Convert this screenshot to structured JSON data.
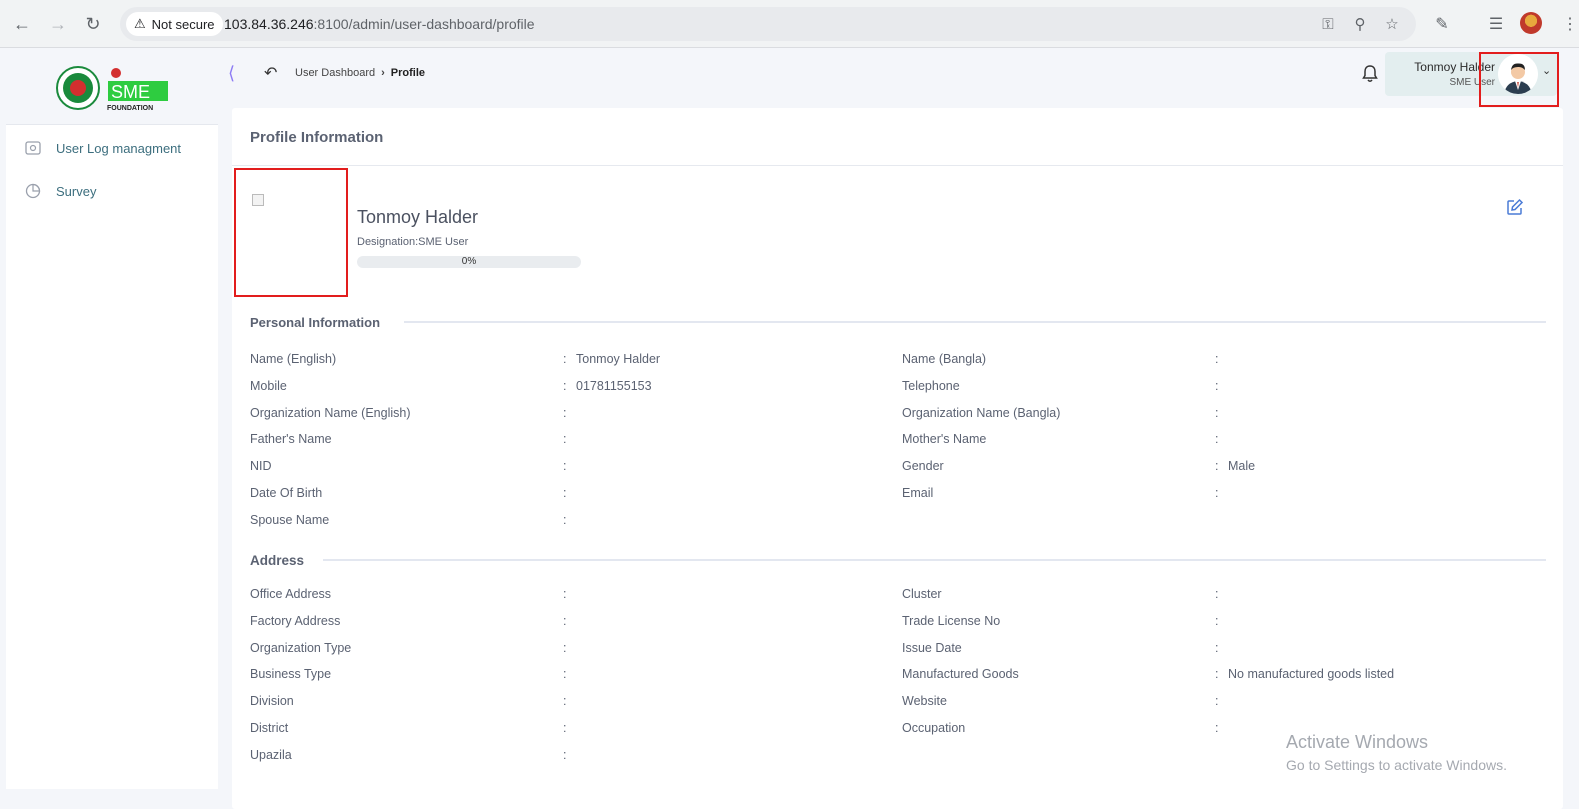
{
  "browser": {
    "security_label": "Not secure",
    "url_host": "103.84.36.246",
    "url_rest": ":8100/admin/user-dashboard/profile"
  },
  "sidebar": {
    "items": [
      {
        "label": "User Log managment",
        "icon": "log-icon"
      },
      {
        "label": "Survey",
        "icon": "pie-chart-icon"
      }
    ]
  },
  "header": {
    "breadcrumb": [
      "User Dashboard",
      "Profile"
    ],
    "user_name": "Tonmoy Halder",
    "user_role": "SME User"
  },
  "profile": {
    "card_title": "Profile Information",
    "name": "Tonmoy Halder",
    "designation": "Designation:SME User",
    "progress_text": "0%",
    "progress_value": 0
  },
  "personal": {
    "title": "Personal Information",
    "left": [
      {
        "label": "Name (English)",
        "value": "Tonmoy Halder"
      },
      {
        "label": "Mobile",
        "value": "01781155153"
      },
      {
        "label": "Organization Name (English)",
        "value": ""
      },
      {
        "label": "Father's Name",
        "value": ""
      },
      {
        "label": "NID",
        "value": ""
      },
      {
        "label": "Date Of Birth",
        "value": ""
      },
      {
        "label": "Spouse Name",
        "value": ""
      }
    ],
    "right": [
      {
        "label": "Name (Bangla)",
        "value": ""
      },
      {
        "label": "Telephone",
        "value": ""
      },
      {
        "label": "Organization Name (Bangla)",
        "value": ""
      },
      {
        "label": "Mother's Name",
        "value": ""
      },
      {
        "label": "Gender",
        "value": "Male"
      },
      {
        "label": "Email",
        "value": ""
      }
    ]
  },
  "address": {
    "title": "Address",
    "left": [
      {
        "label": "Office Address",
        "value": ""
      },
      {
        "label": "Factory Address",
        "value": ""
      },
      {
        "label": "Organization Type",
        "value": ""
      },
      {
        "label": "Business Type",
        "value": ""
      },
      {
        "label": "Division",
        "value": ""
      },
      {
        "label": "District",
        "value": ""
      },
      {
        "label": "Upazila",
        "value": ""
      }
    ],
    "right": [
      {
        "label": "Cluster",
        "value": ""
      },
      {
        "label": "Trade License No",
        "value": ""
      },
      {
        "label": "Issue Date",
        "value": ""
      },
      {
        "label": "Manufactured Goods",
        "value": "No manufactured goods listed"
      },
      {
        "label": "Website",
        "value": ""
      },
      {
        "label": "Occupation",
        "value": ""
      }
    ]
  },
  "watermark": {
    "line1": "Activate Windows",
    "line2": "Go to Settings to activate Windows."
  },
  "colors": {
    "highlight": "#e21d1d",
    "accent": "#4a7bd6",
    "chip": "#e3eeef"
  }
}
